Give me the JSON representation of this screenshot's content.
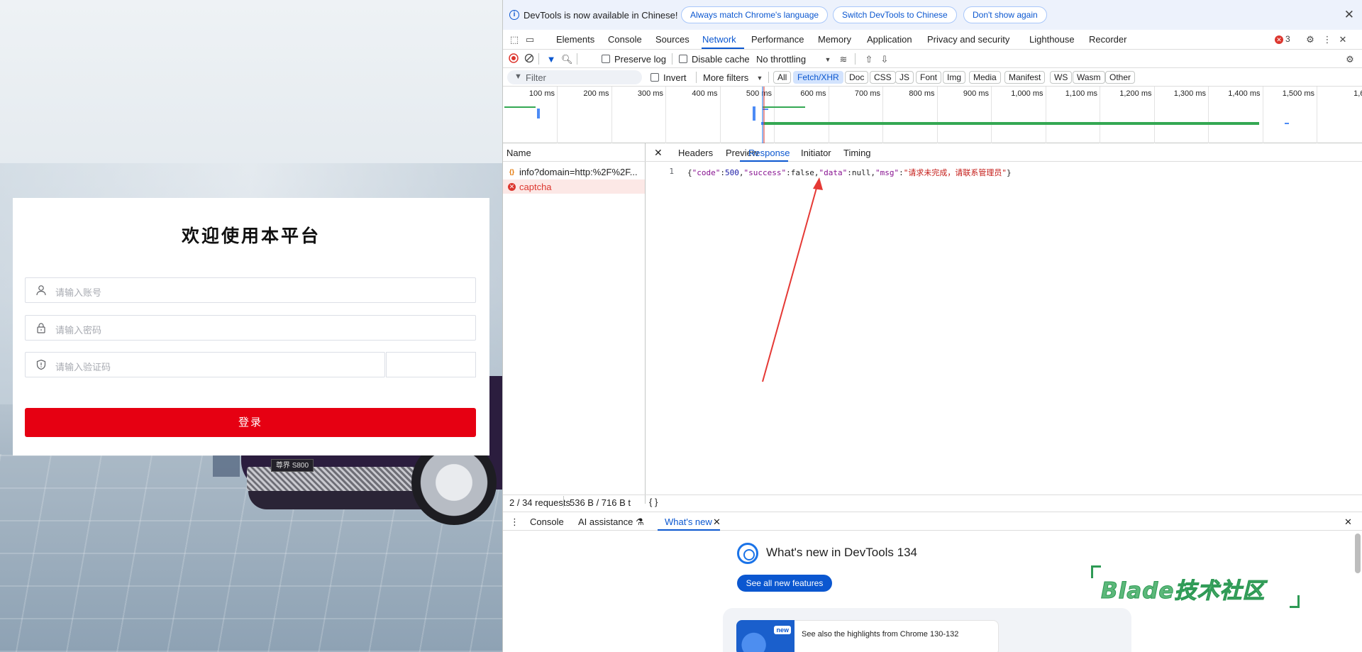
{
  "login": {
    "title": "欢迎使用本平台",
    "account_placeholder": "请输入账号",
    "password_placeholder": "请输入密码",
    "captcha_placeholder": "请输入验证码",
    "login_button": "登录",
    "plate_text": "尊界 S800"
  },
  "devtools": {
    "infobar": {
      "message": "DevTools is now available in Chinese!",
      "btn_match": "Always match Chrome's language",
      "btn_switch": "Switch DevTools to Chinese",
      "btn_dont_show": "Don't show again"
    },
    "tabs": [
      "Elements",
      "Console",
      "Sources",
      "Network",
      "Performance",
      "Memory",
      "Application",
      "Privacy and security",
      "Lighthouse",
      "Recorder"
    ],
    "active_tab": "Network",
    "error_count": "3",
    "toolbar": {
      "preserve_log": "Preserve log",
      "disable_cache": "Disable cache",
      "throttling": "No throttling"
    },
    "filter": {
      "placeholder": "Filter",
      "invert": "Invert",
      "more_filters": "More filters",
      "chips": [
        "All",
        "Fetch/XHR",
        "Doc",
        "CSS",
        "JS",
        "Font",
        "Img",
        "Media",
        "Manifest",
        "WS",
        "Wasm",
        "Other"
      ],
      "active_chip": "Fetch/XHR"
    },
    "timeline_ticks": [
      "100 ms",
      "200 ms",
      "300 ms",
      "400 ms",
      "500 ms",
      "600 ms",
      "700 ms",
      "800 ms",
      "900 ms",
      "1,000 ms",
      "1,100 ms",
      "1,200 ms",
      "1,300 ms",
      "1,400 ms",
      "1,500 ms",
      "1,60"
    ],
    "requests": {
      "header": "Name",
      "items": [
        {
          "name": "info?domain=http:%2F%2F...",
          "status": "ok"
        },
        {
          "name": "captcha",
          "status": "error"
        }
      ]
    },
    "detail_tabs": [
      "Headers",
      "Preview",
      "Response",
      "Initiator",
      "Timing"
    ],
    "active_detail_tab": "Response",
    "response": {
      "line_number": "1",
      "open_brace": "{",
      "k_code": "\"code\"",
      "v_code": "500",
      "k_success": "\"success\"",
      "v_success": "false",
      "k_data": "\"data\"",
      "v_data": "null",
      "k_msg": "\"msg\"",
      "v_msg": "\"请求未完成，请联系管理员\"",
      "close_brace": "}"
    },
    "status": {
      "requests": "2 / 34 requests",
      "transferred": "536 B / 716 B t"
    },
    "drawer": {
      "tabs": [
        "Console",
        "AI assistance",
        "What's new"
      ],
      "active": "What's new"
    },
    "whats_new": {
      "title": "What's new in DevTools 134",
      "button": "See all new features",
      "card_tag": "new",
      "card_text": "See also the highlights from Chrome 130-132"
    }
  },
  "watermark": "Blade技术社区",
  "colors": {
    "login_button": "#e60012",
    "devtools_accent": "#0b57d0",
    "error": "#dc362e",
    "arrow": "#e53935",
    "watermark": "#5cb87a"
  }
}
